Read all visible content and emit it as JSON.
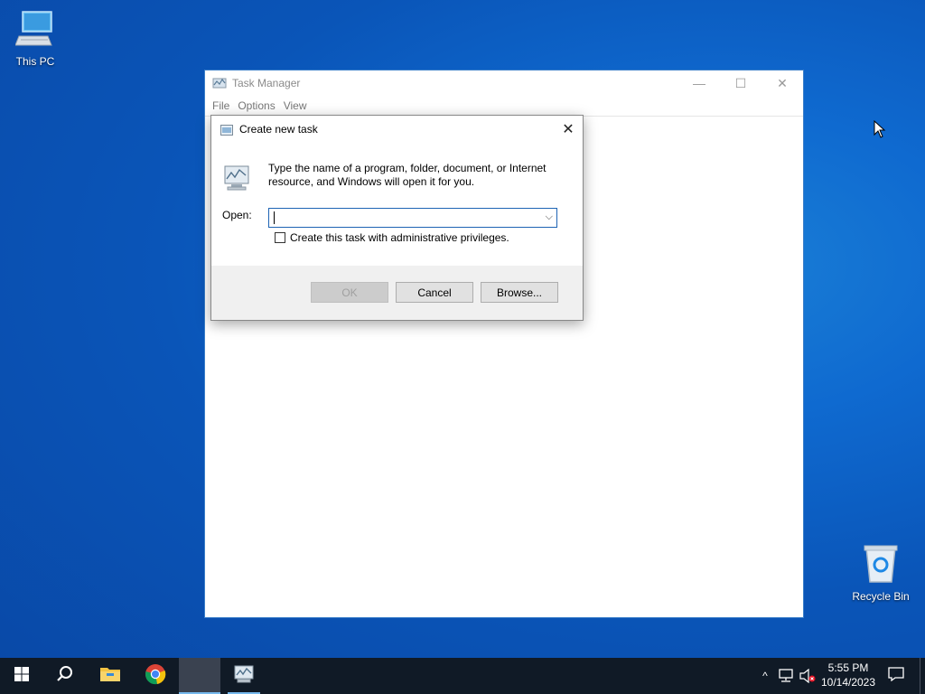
{
  "desktop": {
    "icons": [
      {
        "label": "This PC",
        "icon": "computer-icon"
      },
      {
        "label": "Recycle Bin",
        "icon": "recycle-bin-icon"
      }
    ]
  },
  "task_manager": {
    "title": "Task Manager",
    "icon": "task-manager-icon",
    "menu": [
      "File",
      "Options",
      "View"
    ],
    "controls": {
      "minimize": "—",
      "maximize": "☐",
      "close": "✕"
    }
  },
  "dialog": {
    "title": "Create new task",
    "close": "✕",
    "message": "Type the name of a program, folder, document, or Internet resource, and Windows will open it for you.",
    "open_label": "Open:",
    "open_value": "",
    "combo_arrow": "⌵",
    "admin_checkbox_label": "Create this task with administrative privileges.",
    "admin_checked": false,
    "buttons": {
      "ok": "OK",
      "cancel": "Cancel",
      "browse": "Browse..."
    },
    "ok_disabled": true
  },
  "taskbar": {
    "items": [
      "start-icon",
      "search-icon",
      "file-explorer-icon",
      "chrome-icon",
      "blank-app",
      "task-manager-icon"
    ],
    "tray": {
      "chevron": "^"
    },
    "clock": {
      "time": "5:55 PM",
      "date": "10/14/2023"
    }
  },
  "colors": {
    "desktop_blue": "#0a55b8",
    "taskbar": "#101a26",
    "accent": "#1e64b4"
  }
}
